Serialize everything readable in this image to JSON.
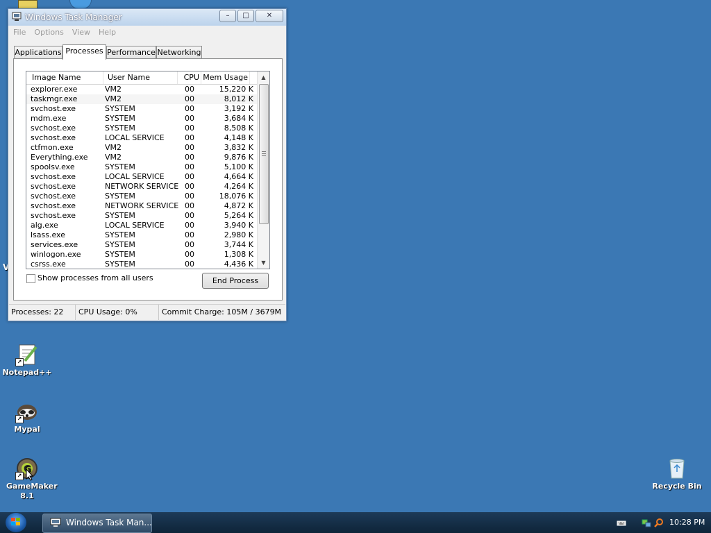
{
  "window": {
    "title": "Windows Task Manager",
    "buttons": {
      "minimize": "–",
      "maximize": "□",
      "close": "✕"
    }
  },
  "menu": [
    "File",
    "Options",
    "View",
    "Help"
  ],
  "tabs": [
    "Applications",
    "Processes",
    "Performance",
    "Networking"
  ],
  "active_tab": "Processes",
  "columns": [
    "Image Name",
    "User Name",
    "CPU",
    "Mem Usage"
  ],
  "processes": [
    {
      "name": "explorer.exe",
      "user": "VM2",
      "cpu": "00",
      "mem": "15,220 K"
    },
    {
      "name": "taskmgr.exe",
      "user": "VM2",
      "cpu": "00",
      "mem": "8,012 K"
    },
    {
      "name": "svchost.exe",
      "user": "SYSTEM",
      "cpu": "00",
      "mem": "3,192 K"
    },
    {
      "name": "mdm.exe",
      "user": "SYSTEM",
      "cpu": "00",
      "mem": "3,684 K"
    },
    {
      "name": "svchost.exe",
      "user": "SYSTEM",
      "cpu": "00",
      "mem": "8,508 K"
    },
    {
      "name": "svchost.exe",
      "user": "LOCAL SERVICE",
      "cpu": "00",
      "mem": "4,148 K"
    },
    {
      "name": "ctfmon.exe",
      "user": "VM2",
      "cpu": "00",
      "mem": "3,832 K"
    },
    {
      "name": "Everything.exe",
      "user": "VM2",
      "cpu": "00",
      "mem": "9,876 K"
    },
    {
      "name": "spoolsv.exe",
      "user": "SYSTEM",
      "cpu": "00",
      "mem": "5,100 K"
    },
    {
      "name": "svchost.exe",
      "user": "LOCAL SERVICE",
      "cpu": "00",
      "mem": "4,664 K"
    },
    {
      "name": "svchost.exe",
      "user": "NETWORK SERVICE",
      "cpu": "00",
      "mem": "4,264 K"
    },
    {
      "name": "svchost.exe",
      "user": "SYSTEM",
      "cpu": "00",
      "mem": "18,076 K"
    },
    {
      "name": "svchost.exe",
      "user": "NETWORK SERVICE",
      "cpu": "00",
      "mem": "4,872 K"
    },
    {
      "name": "svchost.exe",
      "user": "SYSTEM",
      "cpu": "00",
      "mem": "5,264 K"
    },
    {
      "name": "alg.exe",
      "user": "LOCAL SERVICE",
      "cpu": "00",
      "mem": "3,940 K"
    },
    {
      "name": "lsass.exe",
      "user": "SYSTEM",
      "cpu": "00",
      "mem": "2,980 K"
    },
    {
      "name": "services.exe",
      "user": "SYSTEM",
      "cpu": "00",
      "mem": "3,744 K"
    },
    {
      "name": "winlogon.exe",
      "user": "SYSTEM",
      "cpu": "00",
      "mem": "1,308 K"
    },
    {
      "name": "csrss.exe",
      "user": "SYSTEM",
      "cpu": "00",
      "mem": "4,436 K"
    }
  ],
  "show_all_label": "Show processes from all users",
  "show_all_checked": false,
  "end_process_label": "End Process",
  "status": {
    "processes": "Processes: 22",
    "cpu": "CPU Usage: 0%",
    "commit": "Commit Charge: 105M / 3679M"
  },
  "desktop_icons": [
    {
      "label": "Notepad++",
      "icon": "notepad-plus-plus-icon"
    },
    {
      "label": "Mypal",
      "icon": "mypal-raccoon-icon"
    },
    {
      "label": "GameMaker 8.1",
      "icon": "gamemaker-icon"
    },
    {
      "label": "Recycle Bin",
      "icon": "recycle-bin-icon"
    }
  ],
  "stray_desktop_text": "V",
  "taskbar": {
    "task_label": "Windows Task Man...",
    "clock": "10:28 PM"
  },
  "colors": {
    "desktop": "#3b78b4",
    "taskbar": "#16304a"
  }
}
